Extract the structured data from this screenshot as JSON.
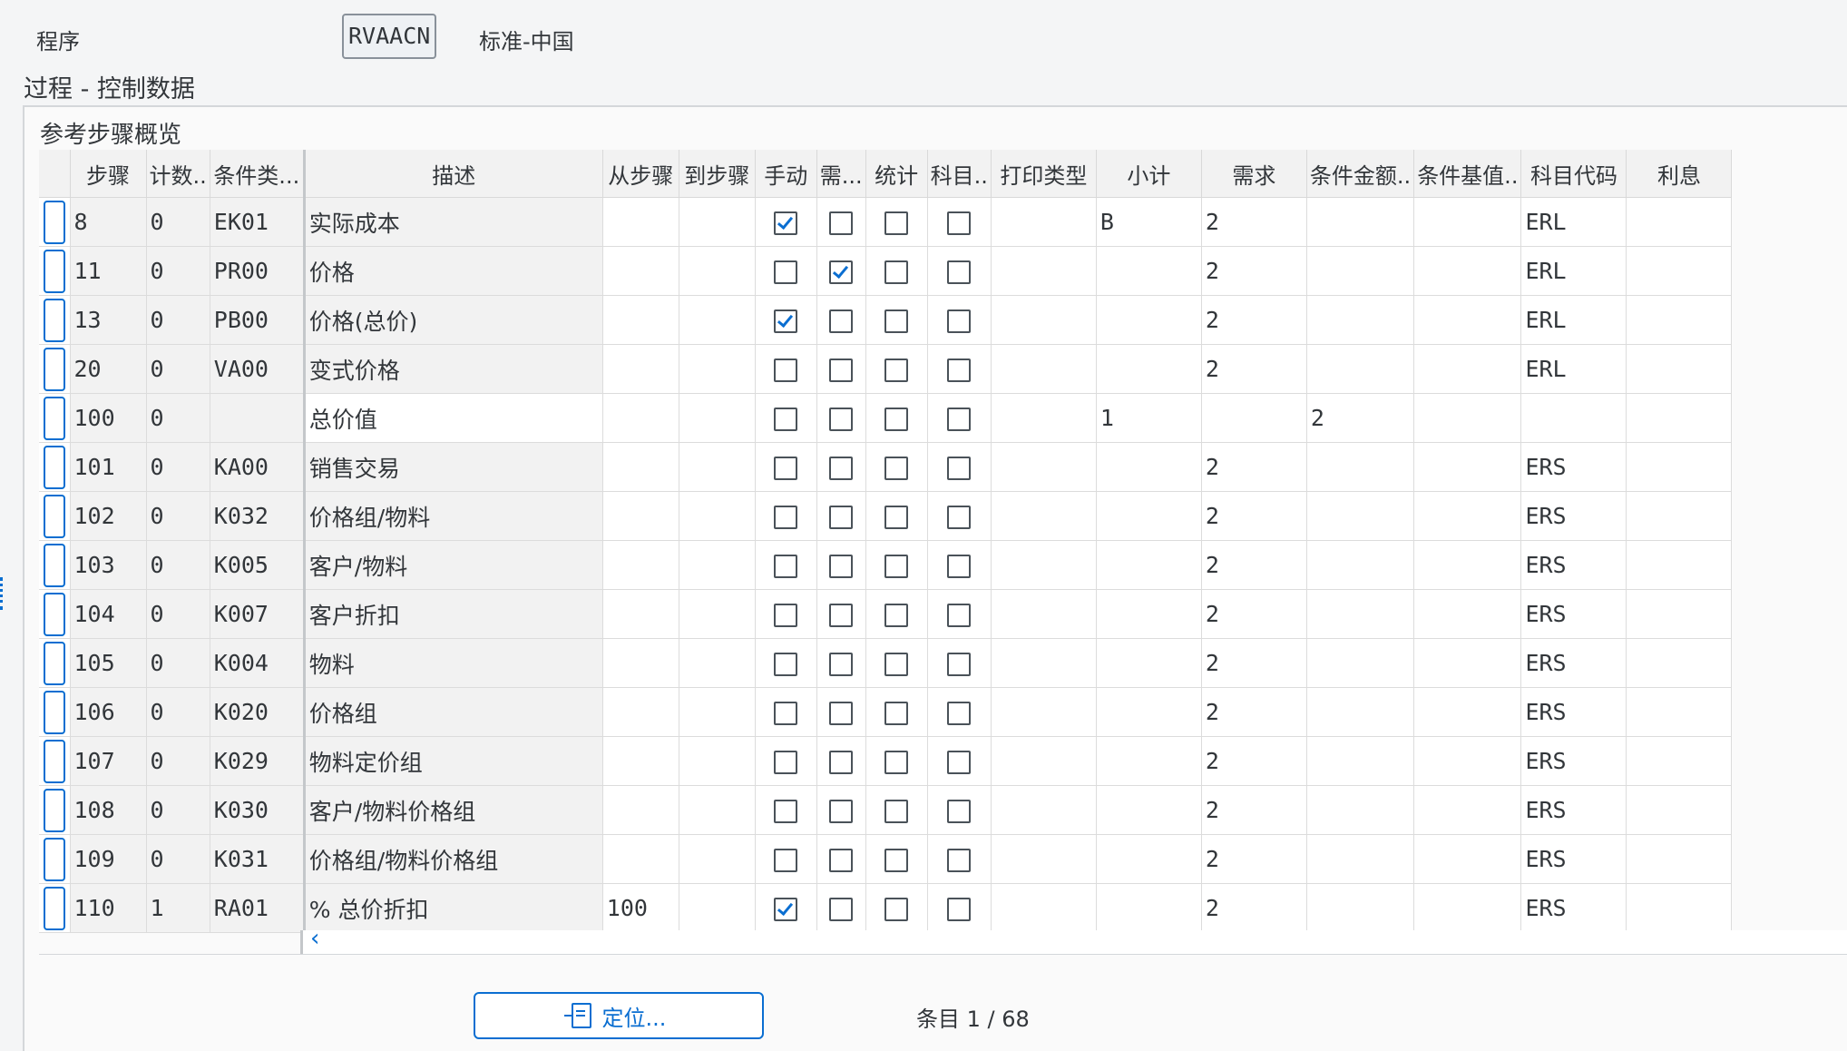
{
  "program": {
    "label": "程序",
    "value": "RVAACN",
    "description": "标准-中国"
  },
  "section_title": "过程 - 控制数据",
  "panel_title": "参考步骤概览",
  "columns": [
    "步骤",
    "计数",
    "条件类型",
    "描述",
    "从步骤",
    "到步骤",
    "手动",
    "需要",
    "统计",
    "科目",
    "打印类型",
    "小计",
    "需求",
    "条件金额",
    "条件基值",
    "科目代码",
    "利息"
  ],
  "column_headers_visible": [
    "步骤",
    "计数..",
    "条件类...",
    "描述",
    "从步骤",
    "到步骤",
    "手动",
    "需...",
    "统计",
    "科目..",
    "打印类型",
    "小计",
    "需求",
    "条件金额..",
    "条件基值..",
    "科目代码",
    "利息"
  ],
  "rows": [
    {
      "step": "8",
      "counter": "0",
      "ctype": "EK01",
      "desc": "实际成本",
      "from": "",
      "to": "",
      "manual": true,
      "required": false,
      "stat": false,
      "account": false,
      "print": "",
      "subtotal": "B",
      "req": "2",
      "calc": "",
      "base": "",
      "acckey": "ERL",
      "accrual": ""
    },
    {
      "step": "11",
      "counter": "0",
      "ctype": "PR00",
      "desc": "价格",
      "from": "",
      "to": "",
      "manual": false,
      "required": true,
      "stat": false,
      "account": false,
      "print": "",
      "subtotal": "",
      "req": "2",
      "calc": "",
      "base": "",
      "acckey": "ERL",
      "accrual": ""
    },
    {
      "step": "13",
      "counter": "0",
      "ctype": "PB00",
      "desc": "价格(总价)",
      "from": "",
      "to": "",
      "manual": true,
      "required": false,
      "stat": false,
      "account": false,
      "print": "",
      "subtotal": "",
      "req": "2",
      "calc": "",
      "base": "",
      "acckey": "ERL",
      "accrual": ""
    },
    {
      "step": "20",
      "counter": "0",
      "ctype": "VA00",
      "desc": "变式价格",
      "from": "",
      "to": "",
      "manual": false,
      "required": false,
      "stat": false,
      "account": false,
      "print": "",
      "subtotal": "",
      "req": "2",
      "calc": "",
      "base": "",
      "acckey": "ERL",
      "accrual": ""
    },
    {
      "step": "100",
      "counter": "0",
      "ctype": "",
      "desc": "总价值",
      "from": "",
      "to": "",
      "manual": false,
      "required": false,
      "stat": false,
      "account": false,
      "print": "",
      "subtotal": "1",
      "req": "",
      "calc": "2",
      "base": "",
      "acckey": "",
      "accrual": ""
    },
    {
      "step": "101",
      "counter": "0",
      "ctype": "KA00",
      "desc": "销售交易",
      "from": "",
      "to": "",
      "manual": false,
      "required": false,
      "stat": false,
      "account": false,
      "print": "",
      "subtotal": "",
      "req": "2",
      "calc": "",
      "base": "",
      "acckey": "ERS",
      "accrual": ""
    },
    {
      "step": "102",
      "counter": "0",
      "ctype": "K032",
      "desc": "价格组/物料",
      "from": "",
      "to": "",
      "manual": false,
      "required": false,
      "stat": false,
      "account": false,
      "print": "",
      "subtotal": "",
      "req": "2",
      "calc": "",
      "base": "",
      "acckey": "ERS",
      "accrual": ""
    },
    {
      "step": "103",
      "counter": "0",
      "ctype": "K005",
      "desc": "客户/物料",
      "from": "",
      "to": "",
      "manual": false,
      "required": false,
      "stat": false,
      "account": false,
      "print": "",
      "subtotal": "",
      "req": "2",
      "calc": "",
      "base": "",
      "acckey": "ERS",
      "accrual": ""
    },
    {
      "step": "104",
      "counter": "0",
      "ctype": "K007",
      "desc": "客户折扣",
      "from": "",
      "to": "",
      "manual": false,
      "required": false,
      "stat": false,
      "account": false,
      "print": "",
      "subtotal": "",
      "req": "2",
      "calc": "",
      "base": "",
      "acckey": "ERS",
      "accrual": ""
    },
    {
      "step": "105",
      "counter": "0",
      "ctype": "K004",
      "desc": "物料",
      "from": "",
      "to": "",
      "manual": false,
      "required": false,
      "stat": false,
      "account": false,
      "print": "",
      "subtotal": "",
      "req": "2",
      "calc": "",
      "base": "",
      "acckey": "ERS",
      "accrual": ""
    },
    {
      "step": "106",
      "counter": "0",
      "ctype": "K020",
      "desc": "价格组",
      "from": "",
      "to": "",
      "manual": false,
      "required": false,
      "stat": false,
      "account": false,
      "print": "",
      "subtotal": "",
      "req": "2",
      "calc": "",
      "base": "",
      "acckey": "ERS",
      "accrual": ""
    },
    {
      "step": "107",
      "counter": "0",
      "ctype": "K029",
      "desc": "物料定价组",
      "from": "",
      "to": "",
      "manual": false,
      "required": false,
      "stat": false,
      "account": false,
      "print": "",
      "subtotal": "",
      "req": "2",
      "calc": "",
      "base": "",
      "acckey": "ERS",
      "accrual": ""
    },
    {
      "step": "108",
      "counter": "0",
      "ctype": "K030",
      "desc": "客户/物料价格组",
      "from": "",
      "to": "",
      "manual": false,
      "required": false,
      "stat": false,
      "account": false,
      "print": "",
      "subtotal": "",
      "req": "2",
      "calc": "",
      "base": "",
      "acckey": "ERS",
      "accrual": ""
    },
    {
      "step": "109",
      "counter": "0",
      "ctype": "K031",
      "desc": "价格组/物料价格组",
      "from": "",
      "to": "",
      "manual": false,
      "required": false,
      "stat": false,
      "account": false,
      "print": "",
      "subtotal": "",
      "req": "2",
      "calc": "",
      "base": "",
      "acckey": "ERS",
      "accrual": ""
    },
    {
      "step": "110",
      "counter": "1",
      "ctype": "RA01",
      "desc": "% 总价折扣",
      "from": "100",
      "to": "",
      "manual": true,
      "required": false,
      "stat": false,
      "account": false,
      "print": "",
      "subtotal": "",
      "req": "2",
      "calc": "",
      "base": "",
      "acckey": "ERS",
      "accrual": ""
    }
  ],
  "footer": {
    "locate_label": "定位...",
    "entry_count": "条目 1 / 68",
    "scroll_left_icon": "chevron-left-icon"
  },
  "colors": {
    "accent": "#0a6ed1",
    "header_bg": "#f2f2f2",
    "grid_line": "#dcdcdc"
  }
}
